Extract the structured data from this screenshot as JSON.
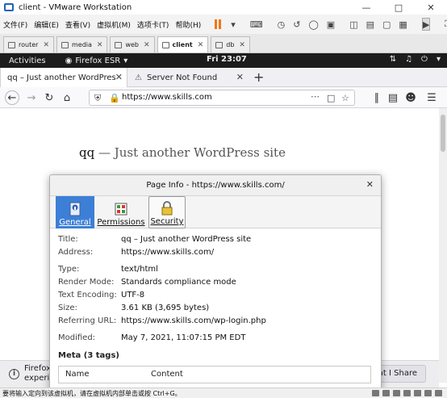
{
  "vmware": {
    "title": "client - VMware Workstation",
    "menu": [
      "文件(F)",
      "编辑(E)",
      "查看(V)",
      "虚拟机(M)",
      "选项卡(T)",
      "帮助(H)"
    ],
    "tabs": [
      {
        "label": "router",
        "active": false
      },
      {
        "label": "media",
        "active": false
      },
      {
        "label": "web",
        "active": false
      },
      {
        "label": "client",
        "active": true
      },
      {
        "label": "db",
        "active": false
      }
    ],
    "status_text": "要将输入定向到该虚拟机，请在虚拟机内部单击或按 Ctrl+G。"
  },
  "gnome": {
    "activities": "Activities",
    "app_name": "Firefox ESR",
    "clock": "Fri 23:07"
  },
  "firefox": {
    "tabs": [
      {
        "label": "qq – Just another WordPres",
        "active": true
      },
      {
        "label": "Server Not Found",
        "active": false
      }
    ],
    "url": "https://www.skills.com",
    "notification_text_1": "Firefox",
    "notification_text_2": "experie",
    "notification_button": "at I Share"
  },
  "page": {
    "site_name": "qq",
    "site_tagline": " — Just another WordPress site"
  },
  "dialog": {
    "title": "Page Info - https://www.skills.com/",
    "tabs": [
      {
        "label": "General",
        "active": true
      },
      {
        "label": "Permissions",
        "active": false
      },
      {
        "label": "Security",
        "active": false
      }
    ],
    "fields": [
      {
        "key": "Title:",
        "value": "qq – Just another WordPress site"
      },
      {
        "key": "Address:",
        "value": "https://www.skills.com/"
      },
      {
        "key": "Type:",
        "value": "text/html"
      },
      {
        "key": "Render Mode:",
        "value": "Standards compliance mode"
      },
      {
        "key": "Text Encoding:",
        "value": "UTF-8"
      },
      {
        "key": "Size:",
        "value": "3.61 KB (3,695 bytes)"
      },
      {
        "key": "Referring URL:",
        "value": "https://www.skills.com/wp-login.php"
      },
      {
        "key": "Modified:",
        "value": "May 7, 2021, 11:07:15 PM EDT"
      }
    ],
    "meta_heading": "Meta (3 tags)",
    "meta_columns": [
      "Name",
      "Content"
    ]
  },
  "colors": {
    "gnome_bar": "#1c1c1c",
    "dialog_tab_active": "#3c7fd6",
    "vmware_pause": "#f07818"
  }
}
